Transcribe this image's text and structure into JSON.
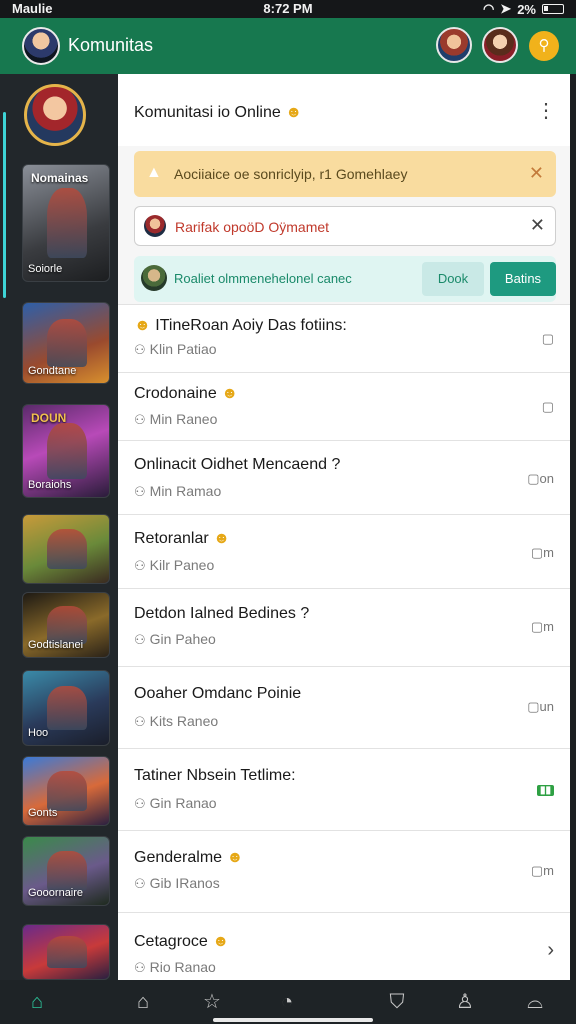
{
  "status_bar": {
    "carrier": "Maulie",
    "time": "8:72 PM",
    "battery": "2%"
  },
  "header": {
    "title": "Komunitas"
  },
  "sidebar": {
    "games": [
      {
        "name": "Soiorle",
        "top_name": "Nomainas"
      },
      {
        "name": "Gondtane"
      },
      {
        "name": "Boraiohs",
        "top_name": "DOUN"
      },
      {
        "name": ""
      },
      {
        "name": "Godtislanei"
      },
      {
        "name": "Hoo"
      },
      {
        "name": "Gonts"
      },
      {
        "name": "Gooornaire"
      },
      {
        "name": ""
      }
    ]
  },
  "main": {
    "section_title": "Komunitasi io Online",
    "warning_banner": {
      "text": "Aociiaice oe sonriclyip, r1 Gomehlaey"
    },
    "user_banner": {
      "text": "Rarifak opoöD Oÿmamet"
    },
    "invite_banner": {
      "text": "Roaliet olmmenehelonel canec",
      "ghost_btn": "Dook",
      "solid_btn": "Batins"
    },
    "posts": [
      {
        "title": "ITineRoan Aoiy Das fotiins:",
        "meta": "Klin Patiao",
        "right": "▢",
        "prefix_emoji": true
      },
      {
        "title": "Crodonaine",
        "meta": "Min Raneo",
        "right": "▢",
        "emoji": true
      },
      {
        "title": "Onlinacit Oidhet Mencaend ?",
        "meta": "Min Ramao",
        "right": "▢on"
      },
      {
        "title": "Retoranlar",
        "meta": "Kilr Paneo",
        "right": "▢m",
        "emoji": true
      },
      {
        "title": "Detdon Ialned Bedines ?",
        "meta": "Gin Paheo",
        "right": "▢m"
      },
      {
        "title": "Ooaher Omdanc Poinie",
        "meta": "Kits Raneo",
        "right": "▢un"
      },
      {
        "title": "Tatiner Nbsein Tetlime:",
        "meta": "Gin Ranao",
        "right": "badge"
      },
      {
        "title": "Genderalme",
        "meta": "Gib IRanos",
        "right": "▢m",
        "emoji": true
      },
      {
        "title": "Cetagroce",
        "meta": "Rio Ranao",
        "right": "›",
        "emoji": true
      }
    ]
  },
  "icons": {
    "search": "search-icon",
    "more": "more-vertical-icon",
    "warning": "warning-icon",
    "close": "close-icon",
    "user_meta": "user-icon"
  },
  "colors": {
    "header_green": "#17784f",
    "accent_teal": "#1e9a80",
    "warning_bg": "#f9dc9f",
    "search_btn": "#f1b21b"
  },
  "nav": {
    "items": [
      {
        "icon": "home-icon",
        "glyph": "⌂",
        "active": true
      },
      {
        "icon": "house-outline-icon",
        "glyph": "⌂"
      },
      {
        "icon": "star-icon",
        "glyph": "☆"
      },
      {
        "icon": "clock-icon",
        "glyph": "◔"
      },
      {
        "icon": "shield-icon",
        "glyph": "⛉"
      },
      {
        "icon": "profile-icon",
        "glyph": "♙"
      },
      {
        "icon": "controller-icon",
        "glyph": "⌓"
      }
    ]
  }
}
